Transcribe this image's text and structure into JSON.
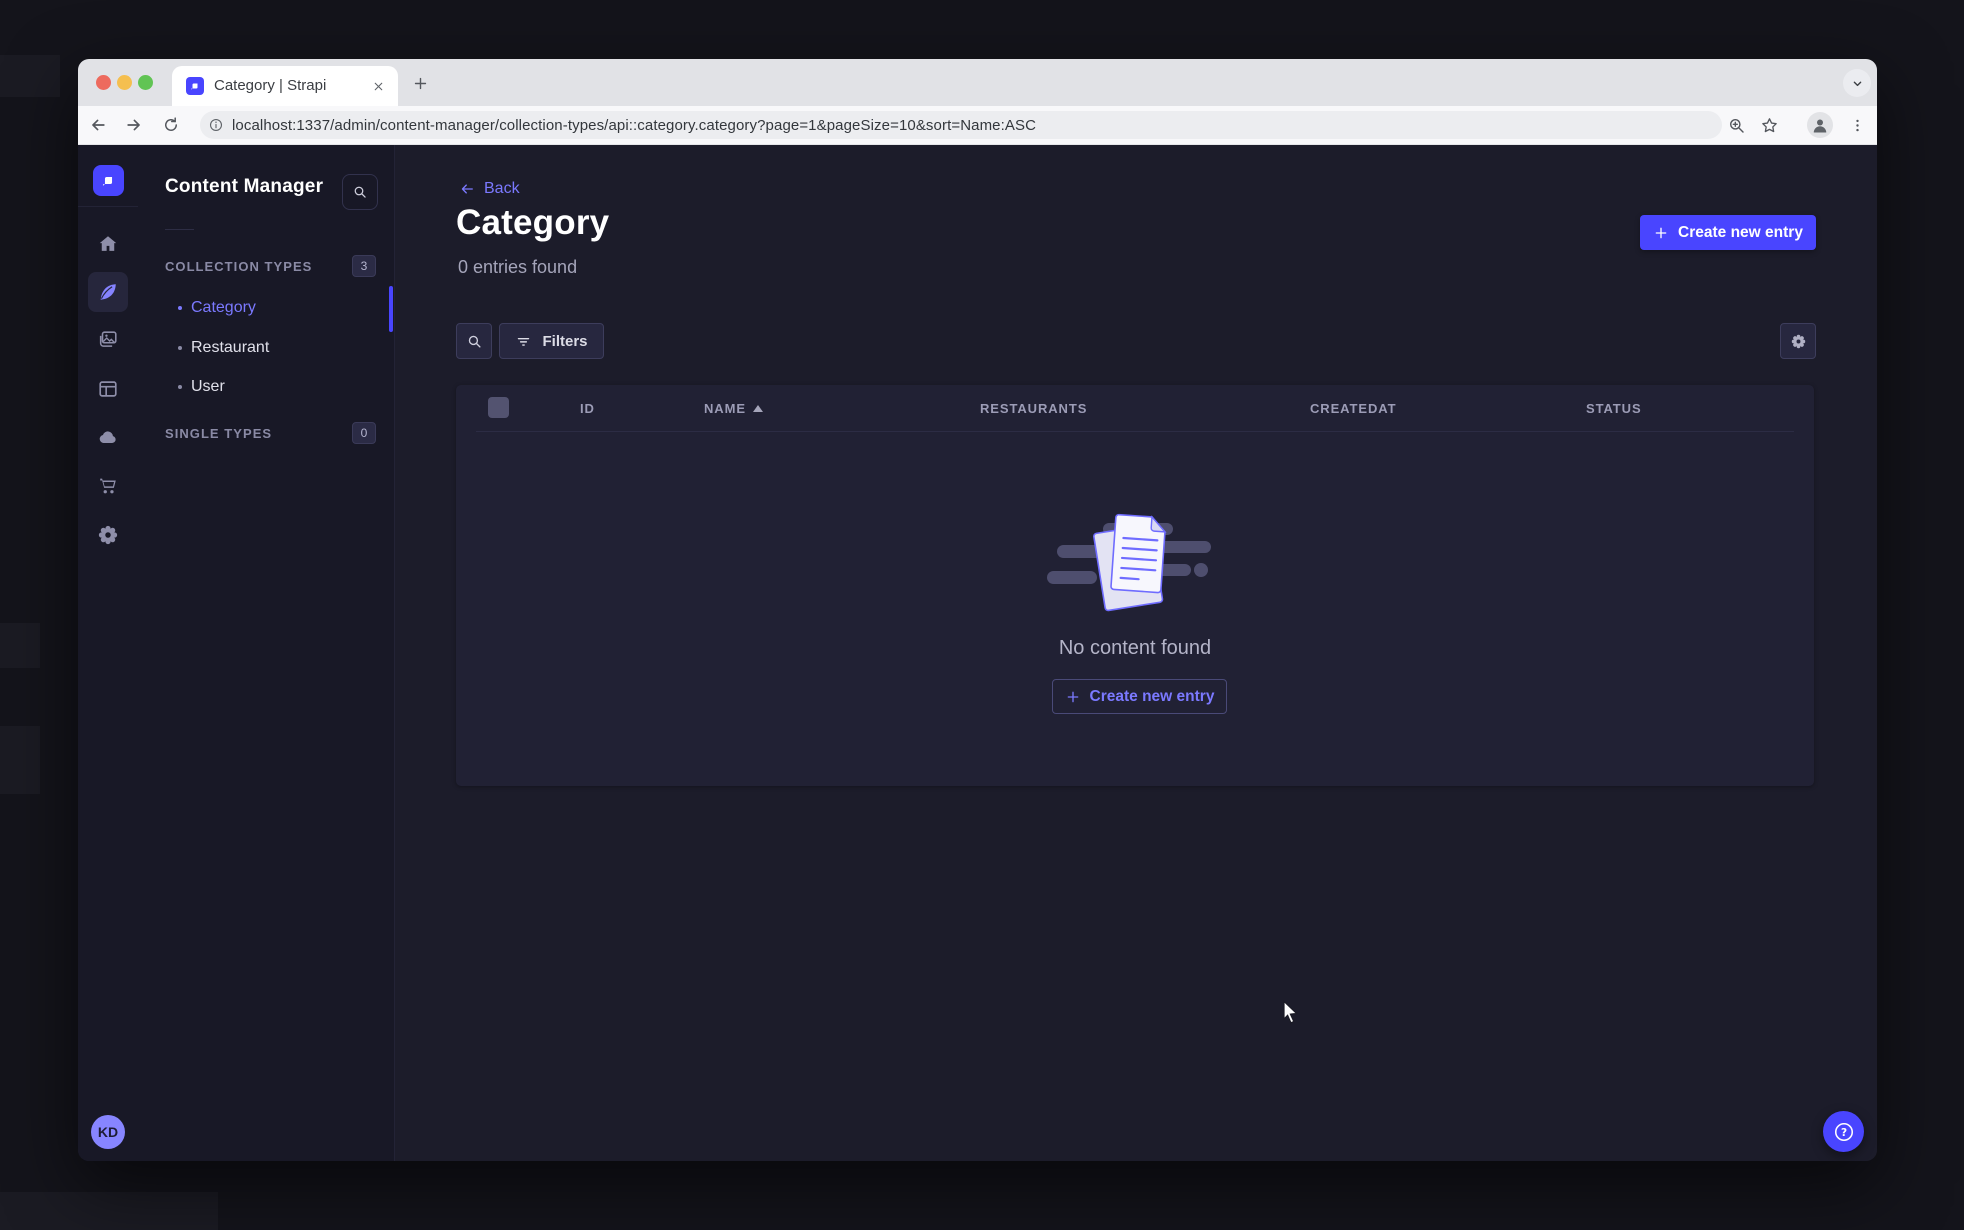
{
  "browser": {
    "tab_title": "Category | Strapi",
    "url": "localhost:1337/admin/content-manager/collection-types/api::category.category?page=1&pageSize=10&sort=Name:ASC"
  },
  "sidebar": {
    "items": [
      {
        "name": "home"
      },
      {
        "name": "content-manager",
        "active": true
      },
      {
        "name": "media-library"
      },
      {
        "name": "content-type-builder"
      },
      {
        "name": "deployments-cloud"
      },
      {
        "name": "marketplace"
      },
      {
        "name": "settings"
      }
    ],
    "user_initials": "KD"
  },
  "subnav": {
    "title": "Content Manager",
    "collection_types": {
      "label": "COLLECTION TYPES",
      "badge": "3",
      "items": [
        {
          "label": "Category",
          "active": true
        },
        {
          "label": "Restaurant",
          "active": false
        },
        {
          "label": "User",
          "active": false
        }
      ]
    },
    "single_types": {
      "label": "SINGLE TYPES",
      "badge": "0"
    }
  },
  "main": {
    "back_label": "Back",
    "title": "Category",
    "subtitle": "0 entries found",
    "create_button_label": "Create new entry",
    "filters_label": "Filters",
    "table": {
      "columns": [
        {
          "label": "ID",
          "sorted": "none"
        },
        {
          "label": "NAME",
          "sorted": "asc"
        },
        {
          "label": "RESTAURANTS",
          "sorted": "none"
        },
        {
          "label": "CREATEDAT",
          "sorted": "none"
        },
        {
          "label": "STATUS",
          "sorted": "none"
        }
      ]
    },
    "empty_state": {
      "message": "No content found",
      "create_button_label": "Create new entry"
    }
  },
  "icons": {
    "help_glyph": "?",
    "traffic_lights": [
      "close",
      "minimize",
      "zoom"
    ],
    "toolbar_icons": [
      "back-arrow",
      "forward-arrow",
      "reload",
      "page-info",
      "zoom-search",
      "bookmark-star",
      "profile",
      "kebab-menu"
    ]
  },
  "colors": {
    "accent": "#4945ff",
    "accent_light": "#7b79ff",
    "page_bg": "#1c1c2a",
    "nav_bg": "#181826",
    "card_bg": "#212134"
  }
}
